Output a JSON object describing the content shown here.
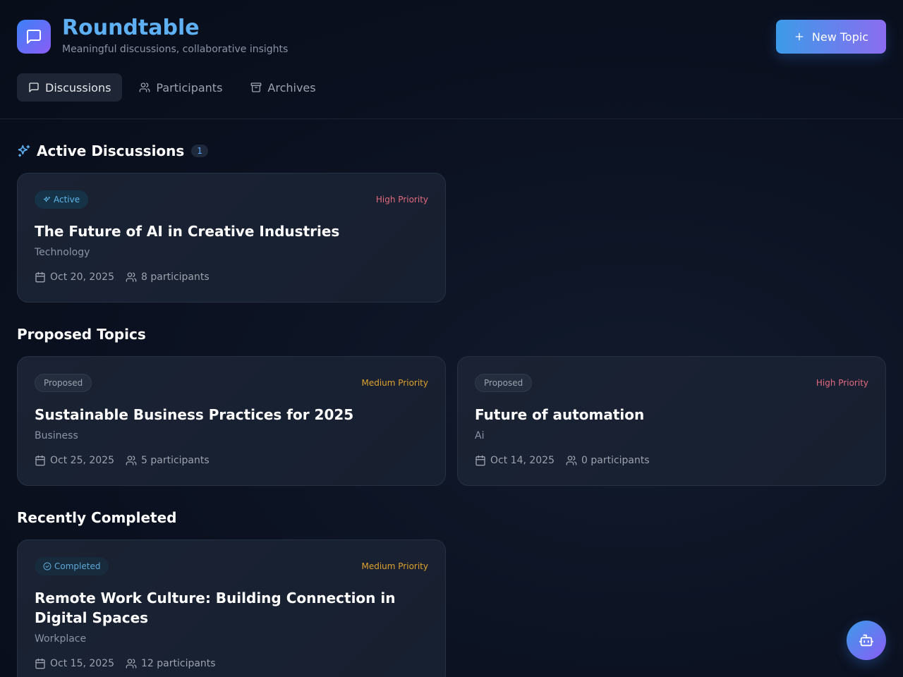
{
  "app": {
    "title": "Roundtable",
    "subtitle": "Meaningful discussions, collaborative insights",
    "logo_icon": "message-square-icon"
  },
  "header": {
    "new_topic_label": "New Topic"
  },
  "tabs": [
    {
      "label": "Discussions",
      "icon": "message-square-icon",
      "active": true
    },
    {
      "label": "Participants",
      "icon": "users-icon",
      "active": false
    },
    {
      "label": "Archives",
      "icon": "archive-icon",
      "active": false
    }
  ],
  "sections": {
    "active": {
      "title": "Active Discussions",
      "count": "1"
    },
    "proposed": {
      "title": "Proposed Topics"
    },
    "completed": {
      "title": "Recently Completed"
    }
  },
  "cards": {
    "active": [
      {
        "status": "Active",
        "priority": "High Priority",
        "title": "The Future of AI in Creative Industries",
        "category": "Technology",
        "date": "Oct 20, 2025",
        "participants": "8 participants"
      }
    ],
    "proposed": [
      {
        "status": "Proposed",
        "priority": "Medium Priority",
        "title": "Sustainable Business Practices for 2025",
        "category": "Business",
        "date": "Oct 25, 2025",
        "participants": "5 participants"
      },
      {
        "status": "Proposed",
        "priority": "High Priority",
        "title": "Future of automation",
        "category": "Ai",
        "date": "Oct 14, 2025",
        "participants": "0 participants"
      }
    ],
    "completed": [
      {
        "status": "Completed",
        "priority": "Medium Priority",
        "title": "Remote Work Culture: Building Connection in Digital Spaces",
        "category": "Workplace",
        "date": "Oct 15, 2025",
        "participants": "12 participants"
      }
    ]
  },
  "colors": {
    "accent": "#5eb0f2",
    "high_priority": "#e36a7f",
    "medium_priority": "#e0a22c",
    "background": "#0b1120"
  },
  "fab": {
    "icon": "bot-icon"
  }
}
